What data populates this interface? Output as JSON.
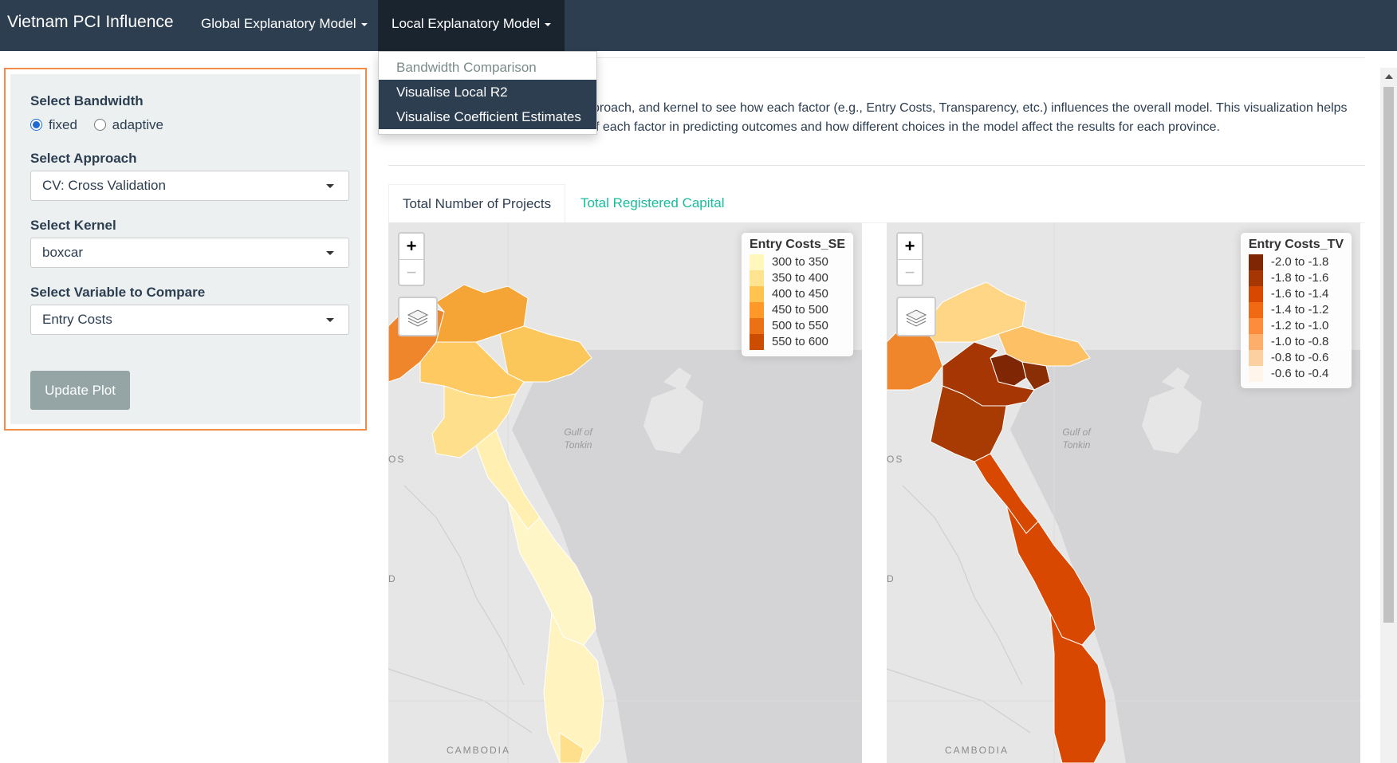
{
  "navbar": {
    "brand": "Vietnam PCI Influence",
    "menus": [
      {
        "label": "Global Explanatory Model"
      },
      {
        "label": "Local Explanatory Model"
      }
    ],
    "dropdown": [
      {
        "label": "Bandwidth Comparison"
      },
      {
        "label": "Visualise Local R2"
      },
      {
        "label": "Visualise Coefficient Estimates"
      }
    ]
  },
  "sidebar": {
    "bandwidth_label": "Select Bandwidth",
    "bandwidth_options": [
      "fixed",
      "adaptive"
    ],
    "bandwidth_selected": "fixed",
    "approach_label": "Select Approach",
    "approach_value": "CV: Cross Validation",
    "kernel_label": "Select Kernel",
    "kernel_value": "boxcar",
    "variable_label": "Select Variable to Compare",
    "variable_value": "Entry Costs",
    "update_button": "Update Plot"
  },
  "main": {
    "description_line1": "proach, and kernel to see how each factor (e.g., Entry Costs, Transparency, etc.) influences the overall model. This visualization helps",
    "description_line2": "f each factor in predicting outcomes and how different choices in the model affect the results for each province.",
    "description_fragment": "g",
    "tabs": [
      {
        "label": "Total Number of Projects"
      },
      {
        "label": "Total Registered Capital"
      }
    ]
  },
  "maps": [
    {
      "legend_title": "Entry Costs_SE",
      "legend": [
        {
          "label": "300 to 350",
          "color": "#fff7bc"
        },
        {
          "label": "350 to 400",
          "color": "#fee391"
        },
        {
          "label": "400 to 450",
          "color": "#fec44f"
        },
        {
          "label": "450 to 500",
          "color": "#fe9929"
        },
        {
          "label": "500 to 550",
          "color": "#ec7014"
        },
        {
          "label": "550 to 600",
          "color": "#cc4c02"
        }
      ],
      "labels": {
        "gulf": "Gulf of\nTonkin",
        "country1": "OS",
        "country2": "CAMBODIA",
        "edge": "D"
      }
    },
    {
      "legend_title": "Entry Costs_TV",
      "legend": [
        {
          "label": "-2.0 to -1.8",
          "color": "#7f2704"
        },
        {
          "label": "-1.8 to -1.6",
          "color": "#a63603"
        },
        {
          "label": "-1.6 to -1.4",
          "color": "#d94801"
        },
        {
          "label": "-1.4 to -1.2",
          "color": "#f16913"
        },
        {
          "label": "-1.2 to -1.0",
          "color": "#fd8d3c"
        },
        {
          "label": "-1.0 to -0.8",
          "color": "#fdae6b"
        },
        {
          "label": "-0.8 to -0.6",
          "color": "#fdd0a2"
        },
        {
          "label": "-0.6 to -0.4",
          "color": "#fff5eb"
        }
      ],
      "labels": {
        "gulf": "Gulf of\nTonkin",
        "country1": "OS",
        "country2": "CAMBODIA",
        "edge": "D"
      }
    }
  ]
}
